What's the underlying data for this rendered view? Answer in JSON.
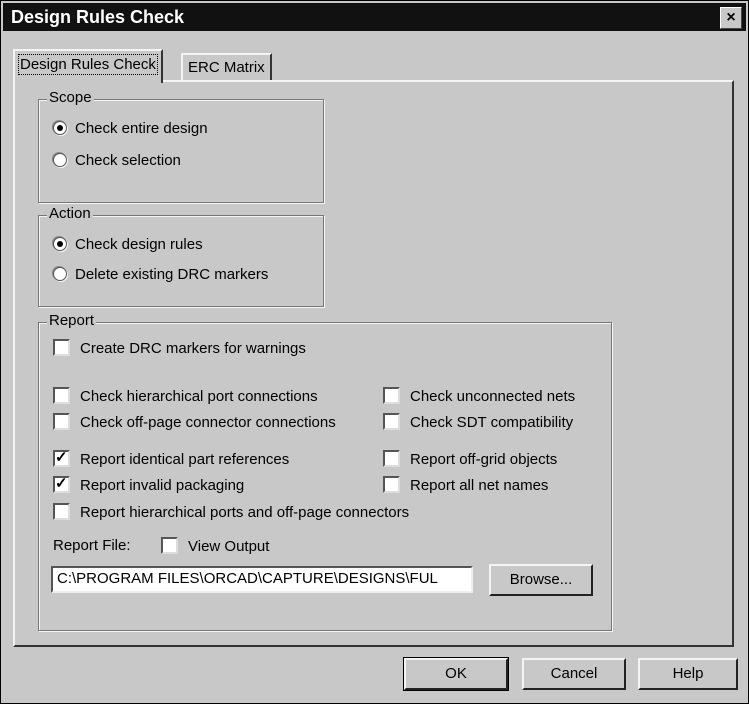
{
  "window": {
    "title": "Design Rules Check",
    "close_glyph": "×"
  },
  "tabs": [
    {
      "label": "Design Rules Check",
      "active": true
    },
    {
      "label": "ERC Matrix",
      "active": false
    }
  ],
  "scope": {
    "legend": "Scope",
    "options": [
      {
        "label": "Check entire design",
        "selected": true
      },
      {
        "label": "Check selection",
        "selected": false
      }
    ]
  },
  "action": {
    "legend": "Action",
    "options": [
      {
        "label": "Check design rules",
        "selected": true
      },
      {
        "label": "Delete existing DRC markers",
        "selected": false
      }
    ]
  },
  "report": {
    "legend": "Report",
    "checks": {
      "create_drc_markers": {
        "label": "Create DRC markers for warnings",
        "checked": false
      },
      "hier_port": {
        "label": "Check hierarchical port connections",
        "checked": false
      },
      "offpage": {
        "label": "Check off-page connector connections",
        "checked": false
      },
      "identical_refs": {
        "label": "Report identical part references",
        "checked": true
      },
      "invalid_pkg": {
        "label": "Report invalid packaging",
        "checked": true
      },
      "hier_ports_offpage": {
        "label": "Report hierarchical ports and off-page connectors",
        "checked": false
      },
      "unconnected": {
        "label": "Check unconnected nets",
        "checked": false
      },
      "sdt": {
        "label": "Check SDT compatibility",
        "checked": false
      },
      "offgrid": {
        "label": "Report off-grid objects",
        "checked": false
      },
      "net_names": {
        "label": "Report all net names",
        "checked": false
      }
    },
    "file_label": "Report File:",
    "view_output": {
      "label": "View Output",
      "checked": false
    },
    "file_value": "C:\\PROGRAM FILES\\ORCAD\\CAPTURE\\DESIGNS\\FUL",
    "browse_label": "Browse..."
  },
  "buttons": {
    "ok": "OK",
    "cancel": "Cancel",
    "help": "Help"
  }
}
